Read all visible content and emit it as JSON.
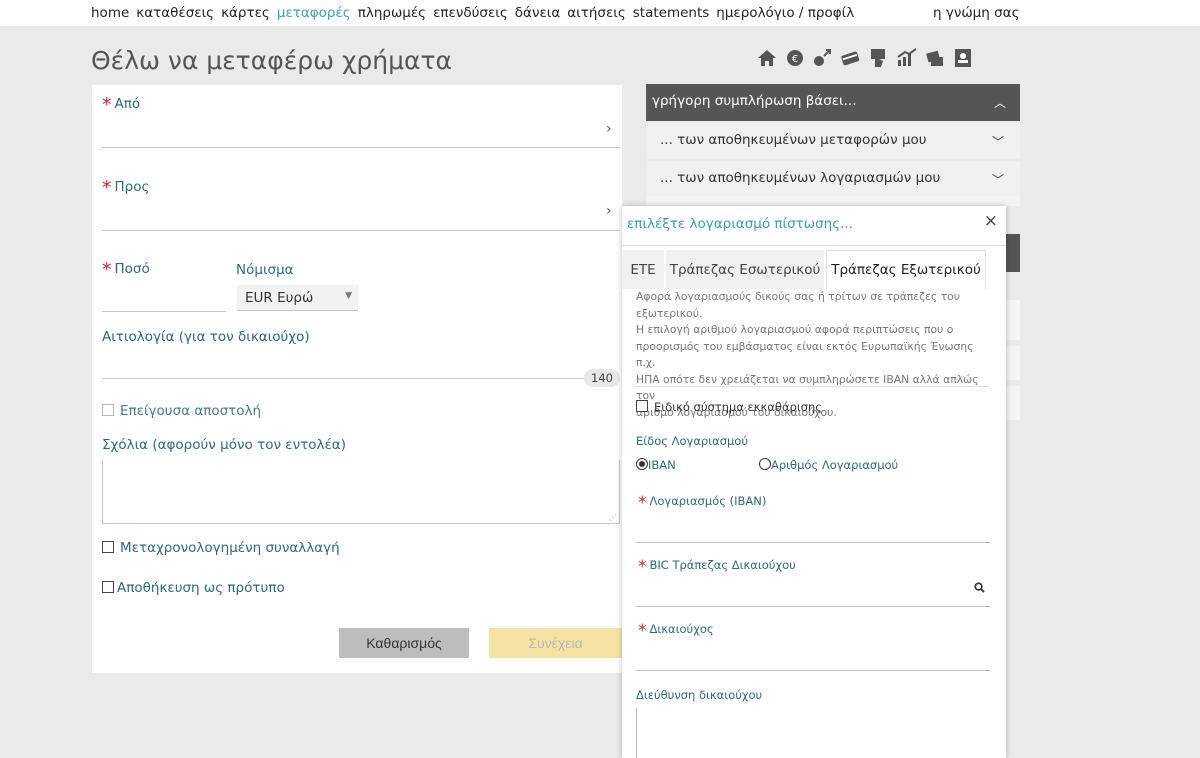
{
  "nav": {
    "items": [
      "home",
      "καταθέσεις",
      "κάρτες",
      "μεταφορές",
      "πληρωμές",
      "επενδύσεις",
      "δάνεια",
      "αιτήσεις",
      "statements",
      "ημερολόγιο / προφίλ"
    ],
    "active_index": 3,
    "feedback": "η γνώμη σας",
    "active_color": "#3aa6a5"
  },
  "page": {
    "title": "Θέλω να μεταφέρω χρήματα"
  },
  "toolbar": {
    "icons": [
      "home-icon",
      "euro-coin-icon",
      "transfer-icon",
      "card-icon",
      "payment-icon",
      "investment-chart-icon",
      "loans-icon",
      "contacts-book-icon"
    ]
  },
  "form": {
    "from_label": "Από",
    "to_label": "Προς",
    "amount_label": "Ποσό",
    "currency_label": "Νόμισμα",
    "currency_value": "EUR Ευρώ",
    "reason_label": "Αιτιολογία (για τον δικαιούχο)",
    "reason_counter": "140",
    "urgent_label": "Επείγουσα αποστολή",
    "comments_label": "Σχόλια (αφορούν μόνο τον εντολέα)",
    "scheduled_label": "Μεταχρονολογημένη συναλλαγή",
    "template_label": "Αποθήκευση ως πρότυπο",
    "clear_button": "Καθαρισμός",
    "continue_button": "Συνέχεια"
  },
  "quick_fill": {
    "header": "γρήγορη συμπλήρωση βάσει...",
    "items": [
      "... των αποθηκευμένων μεταφορών μου",
      "... των αποθηκευμένων λογαριασμών μου"
    ]
  },
  "modal": {
    "title": "επιλέξτε λογαριασμό πίστωσης...",
    "close": "×",
    "tabs": [
      "ΕΤΕ",
      "Τράπεζας Εσωτερικού",
      "Τράπεζας Εξωτερικού"
    ],
    "active_tab": 2,
    "desc_lines": [
      "Αφορά λογαριασμούς δικούς σας ή τρίτων σε τράπεζες του",
      "εξωτερικού.",
      "Η επιλογή αριθμού λογαριασμού αφορά περιπτώσεις που ο",
      "προορισμός του εμβάσματος είναι εκτός Ευρωπαϊκής Ένωσης π.χ.",
      "ΗΠΑ οπότε δεν χρειάζεται να συμπληρώσετε IBAN αλλά απλώς τον",
      "αριθμό λογαριασμού του δικαιούχου."
    ],
    "special_clearing_label": "Ειδικό σύστημα εκκαθάρισης",
    "account_type_label": "Είδος Λογαριασμού",
    "radio_iban": "IBAN",
    "radio_account_number": "Αριθμός Λογαριασμού",
    "iban_label": "Λογαριασμός (IBAN)",
    "bic_label": "BIC Τράπεζας Δικαιούχου",
    "beneficiary_label": "Δικαιούχος",
    "address_label": "Διεύθυνση δικαιούχου"
  },
  "colors": {
    "accent": "#3aa6a5",
    "required": "#c82828",
    "label": "#2c6a7a",
    "dark_header": "#555555",
    "continue_bg": "#f6e3a3"
  }
}
